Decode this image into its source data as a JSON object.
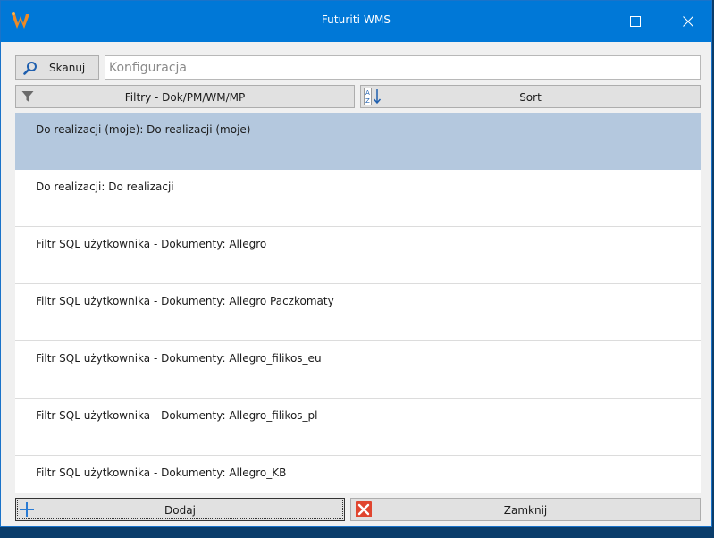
{
  "window": {
    "title": "Futuriti WMS",
    "colors": {
      "titlebar": "#0078d7",
      "selection": "#b4c8de",
      "logo": "#f08a24"
    }
  },
  "titlebar": {
    "logo_icon": "futuriti-logo-icon",
    "maximize_icon": "maximize-icon",
    "close_icon": "close-icon"
  },
  "toolbar": {
    "scan_label": "Skanuj",
    "scan_icon": "search-icon",
    "search_placeholder": "Konfiguracja",
    "search_value": "",
    "filter_label": "Filtry - Dok/PM/WM/MP",
    "filter_icon": "funnel-icon",
    "sort_label": "Sort",
    "sort_icon": "sort-az-icon"
  },
  "list": {
    "items": [
      {
        "label": "Do realizacji (moje): Do realizacji (moje)",
        "selected": true
      },
      {
        "label": "Do realizacji: Do realizacji",
        "selected": false
      },
      {
        "label": "Filtr SQL użytkownika - Dokumenty: Allegro",
        "selected": false
      },
      {
        "label": "Filtr SQL użytkownika - Dokumenty: Allegro Paczkomaty",
        "selected": false
      },
      {
        "label": "Filtr SQL użytkownika - Dokumenty: Allegro_filikos_eu",
        "selected": false
      },
      {
        "label": "Filtr SQL użytkownika - Dokumenty: Allegro_filikos_pl",
        "selected": false
      },
      {
        "label": "Filtr SQL użytkownika - Dokumenty: Allegro_KB",
        "selected": false
      }
    ]
  },
  "footer": {
    "add_label": "Dodaj",
    "add_icon": "plus-icon",
    "close_label": "Zamknij",
    "close_icon": "close-box-icon"
  }
}
